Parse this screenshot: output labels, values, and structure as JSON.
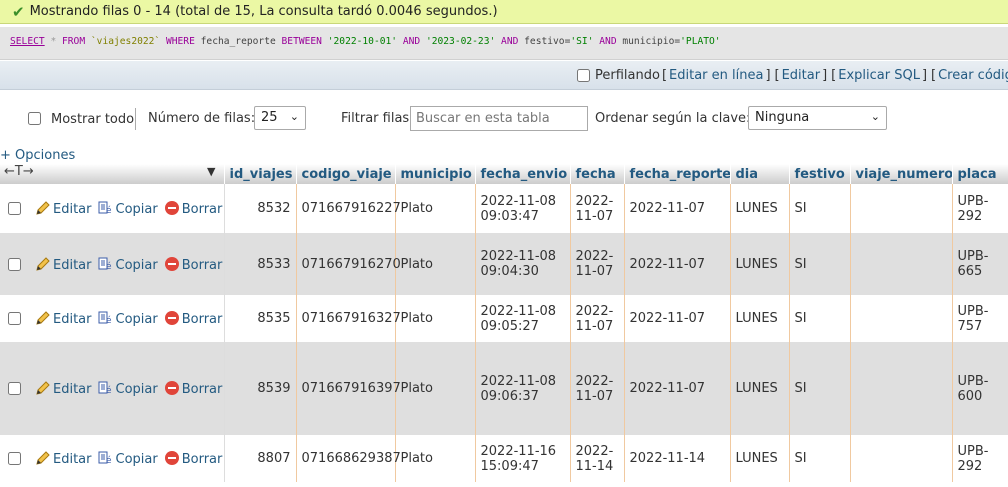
{
  "status": {
    "message": "Mostrando filas 0 - 14 (total de 15, La consulta tardó 0.0046 segundos.)"
  },
  "sql": {
    "select": "SELECT",
    "star": "*",
    "from": "FROM",
    "table": "`viajes2022`",
    "where": "WHERE",
    "field1": "fecha_reporte",
    "between": "BETWEEN",
    "date1": "'2022-10-01'",
    "and1": "AND",
    "date2": "'2023-02-23'",
    "and2": "AND",
    "field2": "festivo=",
    "val2": "'SI'",
    "and3": "AND",
    "field3": "municipio=",
    "val3": "'PLATO'"
  },
  "links": {
    "perfilando": "Perfilando",
    "editar_en_linea": "Editar en línea",
    "editar": "Editar",
    "explicar_sql": "Explicar SQL",
    "crear_codigo": "Crear código PHP"
  },
  "nav": {
    "mostrar_todo": "Mostrar todo",
    "numero_filas_label": "Número de filas:",
    "numero_filas_value": "25",
    "filtrar_label": "Filtrar filas:",
    "filtrar_placeholder": "Buscar en esta tabla",
    "ordenar_label": "Ordenar según la clave:",
    "ordenar_value": "Ninguna"
  },
  "options_label": "+ Opciones",
  "columns": [
    "id_viajes",
    "codigo_viaje",
    "municipio",
    "fecha_envio",
    "fecha",
    "fecha_reporte",
    "dia",
    "festivo",
    "viaje_numero",
    "placa"
  ],
  "action_labels": {
    "edit": "Editar",
    "copy": "Copiar",
    "delete": "Borrar"
  },
  "rows": [
    {
      "id_viajes": "8532",
      "codigo_viaje": "071667916227",
      "municipio": "Plato",
      "fecha_envio_1": "2022-11-08",
      "fecha_envio_2": "09:03:47",
      "fecha_1": "2022-",
      "fecha_2": "11-07",
      "fecha_reporte": "2022-11-07",
      "dia": "LUNES",
      "festivo": "SI",
      "viaje_numero": "",
      "placa_1": "UPB-",
      "placa_2": "292"
    },
    {
      "id_viajes": "8533",
      "codigo_viaje": "071667916270",
      "municipio": "Plato",
      "fecha_envio_1": "2022-11-08",
      "fecha_envio_2": "09:04:30",
      "fecha_1": "2022-",
      "fecha_2": "11-07",
      "fecha_reporte": "2022-11-07",
      "dia": "LUNES",
      "festivo": "SI",
      "viaje_numero": "",
      "placa_1": "UPB-",
      "placa_2": "665"
    },
    {
      "id_viajes": "8535",
      "codigo_viaje": "071667916327",
      "municipio": "Plato",
      "fecha_envio_1": "2022-11-08",
      "fecha_envio_2": "09:05:27",
      "fecha_1": "2022-",
      "fecha_2": "11-07",
      "fecha_reporte": "2022-11-07",
      "dia": "LUNES",
      "festivo": "SI",
      "viaje_numero": "",
      "placa_1": "UPB-",
      "placa_2": "757"
    },
    {
      "id_viajes": "8539",
      "codigo_viaje": "071667916397",
      "municipio": "Plato",
      "fecha_envio_1": "2022-11-08",
      "fecha_envio_2": "09:06:37",
      "fecha_1": "2022-",
      "fecha_2": "11-07",
      "fecha_reporte": "2022-11-07",
      "dia": "LUNES",
      "festivo": "SI",
      "viaje_numero": "",
      "placa_1": "UPB-",
      "placa_2": "600"
    },
    {
      "id_viajes": "8807",
      "codigo_viaje": "071668629387",
      "municipio": "Plato",
      "fecha_envio_1": "2022-11-16",
      "fecha_envio_2": "15:09:47",
      "fecha_1": "2022-",
      "fecha_2": "11-14",
      "fecha_reporte": "2022-11-14",
      "dia": "LUNES",
      "festivo": "SI",
      "viaje_numero": "",
      "placa_1": "UPB-",
      "placa_2": "292"
    }
  ]
}
